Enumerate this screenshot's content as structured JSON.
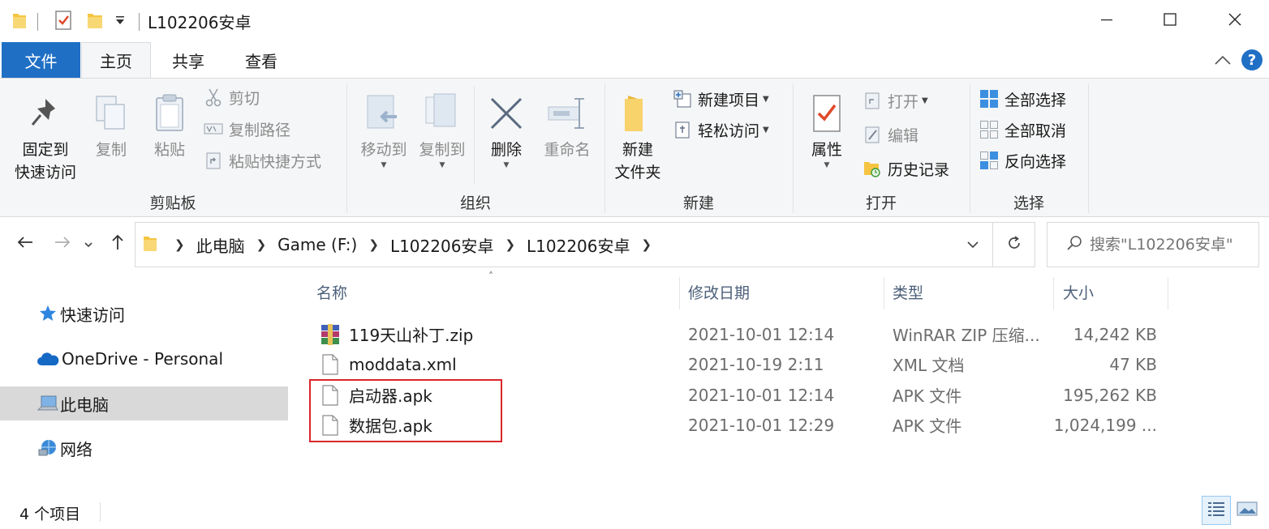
{
  "window": {
    "title": "L102206安卓"
  },
  "tabs": {
    "file": "文件",
    "home": "主页",
    "share": "共享",
    "view": "查看"
  },
  "help": "?",
  "ribbon": {
    "clipboard": {
      "label": "剪贴板",
      "pin_line1": "固定到",
      "pin_line2": "快速访问",
      "copy": "复制",
      "paste": "粘贴",
      "cut": "剪切",
      "copy_path": "复制路径",
      "paste_shortcut": "粘贴快捷方式"
    },
    "organize": {
      "label": "组织",
      "move_to": "移动到",
      "copy_to": "复制到",
      "delete": "删除",
      "rename": "重命名"
    },
    "new": {
      "label": "新建",
      "new_folder_line1": "新建",
      "new_folder_line2": "文件夹",
      "new_item": "新建项目",
      "easy_access": "轻松访问"
    },
    "open": {
      "label": "打开",
      "properties": "属性",
      "open": "打开",
      "edit": "编辑",
      "history": "历史记录"
    },
    "select": {
      "label": "选择",
      "select_all": "全部选择",
      "select_none": "全部取消",
      "invert": "反向选择"
    }
  },
  "address": {
    "crumbs": [
      "此电脑",
      "Game (F:)",
      "L102206安卓",
      "L102206安卓"
    ],
    "search_placeholder": "搜索\"L102206安卓\""
  },
  "nav_pane": {
    "quick_access": "快速访问",
    "onedrive": "OneDrive - Personal",
    "this_pc": "此电脑",
    "network": "网络"
  },
  "columns": {
    "name": "名称",
    "date": "修改日期",
    "type": "类型",
    "size": "大小"
  },
  "files": [
    {
      "name": "119天山补丁.zip",
      "date": "2021-10-01 12:14",
      "type": "WinRAR ZIP 压缩...",
      "size": "14,242 KB",
      "icon": "winrar-archive-icon"
    },
    {
      "name": "moddata.xml",
      "date": "2021-10-19 2:11",
      "type": "XML 文档",
      "size": "47 KB",
      "icon": "document-icon"
    },
    {
      "name": "启动器.apk",
      "date": "2021-10-01 12:14",
      "type": "APK 文件",
      "size": "195,262 KB",
      "icon": "document-icon"
    },
    {
      "name": "数据包.apk",
      "date": "2021-10-01 12:29",
      "type": "APK 文件",
      "size": "1,024,199 ...",
      "icon": "document-icon"
    }
  ],
  "status": {
    "item_count": "4 个项目"
  },
  "colors": {
    "file_tab": "#1f6fc5",
    "ribbon_bg": "#f5f6f7",
    "selected_nav": "#d9d9d9",
    "highlight_box": "#d9262c",
    "folder_yellow": "#f5c542"
  }
}
